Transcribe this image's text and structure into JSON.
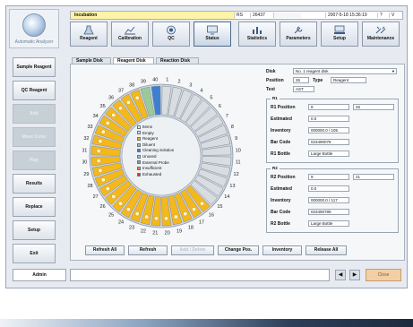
{
  "logo": {
    "text": "Automatic Analyzer"
  },
  "status": {
    "text": "Incubation",
    "cells": [
      "RS",
      "26437",
      "",
      "2007-5-18 15:36:19",
      "?",
      "V"
    ]
  },
  "toolbar": {
    "items": [
      {
        "label": "Reagent",
        "icon": "flask-icon"
      },
      {
        "label": "Calibration",
        "icon": "chart-icon"
      },
      {
        "label": "QC",
        "icon": "target-icon"
      },
      {
        "label": "Status",
        "icon": "monitor-icon",
        "active": true
      },
      {
        "label": "Statistics",
        "icon": "bar-chart-icon"
      },
      {
        "label": "Parameters",
        "icon": "wrench-icon"
      },
      {
        "label": "Setup",
        "icon": "computer-icon"
      },
      {
        "label": "Maintenance",
        "icon": "tools-icon"
      }
    ]
  },
  "sidebar": {
    "items": [
      {
        "label": "Sample Reagent",
        "enabled": true
      },
      {
        "label": "QC Reagent",
        "enabled": true
      },
      {
        "label": "Add",
        "enabled": false
      },
      {
        "label": "Move Color",
        "enabled": false
      },
      {
        "label": "Play",
        "enabled": false
      },
      {
        "label": "Results",
        "enabled": true
      },
      {
        "label": "Replace",
        "enabled": true
      },
      {
        "label": "Setup",
        "enabled": true
      },
      {
        "label": "Exit",
        "enabled": true
      }
    ]
  },
  "tabs": [
    {
      "label": "Sample Disk",
      "active": false
    },
    {
      "label": "Reagent Disk",
      "active": true
    },
    {
      "label": "Reaction Disk",
      "active": false
    }
  ],
  "carousel": {
    "outer_labels": [
      "1",
      "2",
      "3",
      "4",
      "5",
      "6",
      "7",
      "8",
      "9",
      "10",
      "11",
      "12",
      "13",
      "14",
      "15",
      "16",
      "17",
      "18",
      "19",
      "20",
      "21",
      "22",
      "23",
      "24",
      "25",
      "26",
      "27",
      "28",
      "29",
      "30",
      "31",
      "32",
      "33",
      "34",
      "35",
      "36",
      "37",
      "38",
      "39",
      "40"
    ],
    "slot_states": [
      "empty",
      "empty",
      "empty",
      "empty",
      "empty",
      "empty",
      "empty",
      "empty",
      "empty",
      "empty",
      "empty",
      "empty",
      "empty",
      "empty",
      "empty",
      "reagent",
      "reagent",
      "reagent",
      "reagent",
      "reagent",
      "reagent",
      "reagent",
      "reagent",
      "reagent",
      "reagent",
      "reagent",
      "reagent",
      "reagent",
      "reagent",
      "reagent",
      "reagent",
      "reagent",
      "reagent",
      "reagent",
      "reagent",
      "reagent",
      "reagent",
      "reagent",
      "diluent",
      "cleaning"
    ],
    "colors": {
      "reagent": "#f5b81c",
      "empty": "#d9dde2",
      "cleaning": "#3f7fcf",
      "diluent": "#9cc99a",
      "ise": "#c7d7ef"
    }
  },
  "legend": {
    "items": [
      {
        "label": "Items",
        "color": "#ffffff"
      },
      {
        "label": "Empty",
        "color": "#d9dde2"
      },
      {
        "label": "Reagent",
        "color": "#f5b81c"
      },
      {
        "label": "Diluent",
        "color": "#9cc99a"
      },
      {
        "label": "Cleaning Solution",
        "color": "#3f7fcf"
      },
      {
        "label": "Unused",
        "color": "#b9c4d1"
      },
      {
        "label": "External Probe",
        "color": "#8a9bb2"
      },
      {
        "label": "Insufficient",
        "color": "#f07c3a"
      },
      {
        "label": "Exhausted",
        "color": "#d43b3b"
      }
    ]
  },
  "detail": {
    "disk_label": "Disk",
    "disk_value": "No. 1 reagent disk",
    "position_label": "Position",
    "position_value": "26",
    "type_label": "Type",
    "type_value": "Reagent",
    "test_label": "Test",
    "test_value": "AST",
    "r1": {
      "title": "R1",
      "rows": [
        {
          "label": "R1 Position",
          "value": "9",
          "extra": "26"
        },
        {
          "label": "Estimated",
          "value": "0.0"
        },
        {
          "label": "Inventory",
          "value": "000000.0 / 105"
        },
        {
          "label": "Bar Code",
          "value": "023490078"
        },
        {
          "label": "R1 Bottle",
          "value": "Large Bottle"
        }
      ]
    },
    "r2": {
      "title": "R2",
      "rows": [
        {
          "label": "R2 Position",
          "value": "9",
          "extra": "21"
        },
        {
          "label": "Estimated",
          "value": "0.0"
        },
        {
          "label": "Inventory",
          "value": "000000.0 / 117"
        },
        {
          "label": "Bar Code",
          "value": "023490789"
        },
        {
          "label": "R2 Bottle",
          "value": "Large Bottle"
        }
      ]
    }
  },
  "actions": [
    {
      "label": "Refresh All",
      "enabled": true
    },
    {
      "label": "Refresh",
      "enabled": true
    },
    {
      "label": "Add / Delete",
      "enabled": false
    },
    {
      "label": "Change Pos.",
      "enabled": true
    },
    {
      "label": "Inventory",
      "enabled": true
    },
    {
      "label": "Release All",
      "enabled": true
    }
  ],
  "footer": {
    "user": "Admin",
    "prev": "◀",
    "next": "▶",
    "close": "Close"
  }
}
